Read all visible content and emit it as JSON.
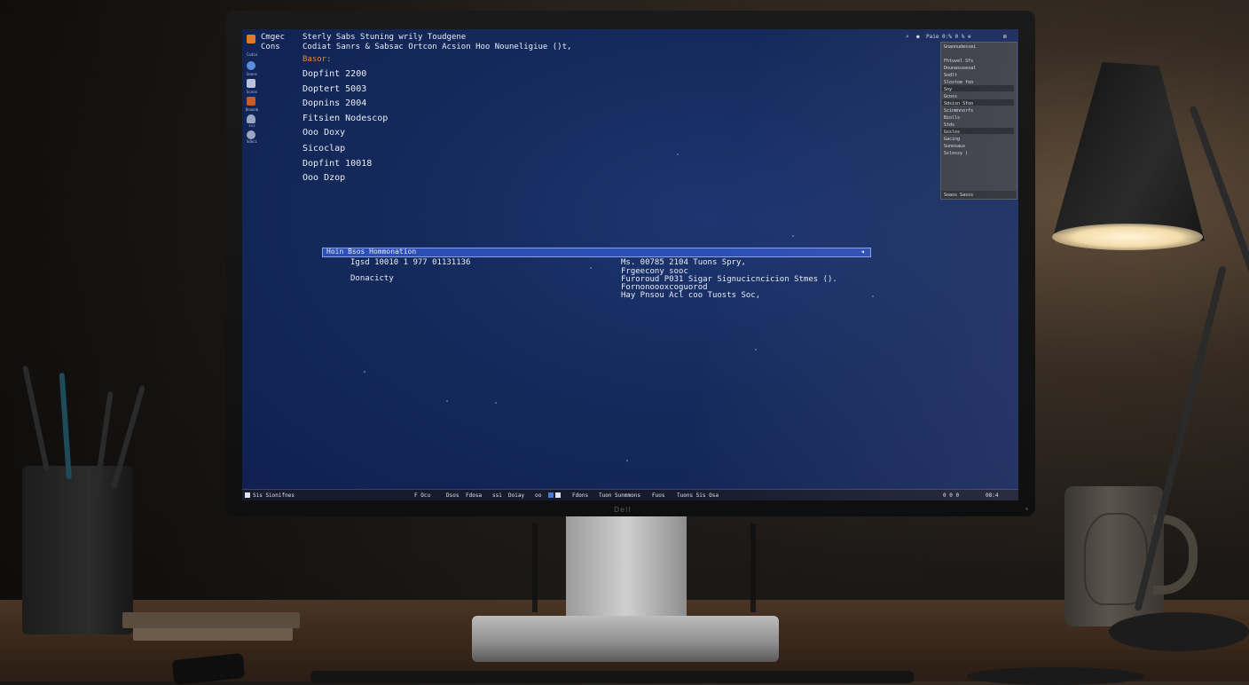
{
  "screen": {
    "header": {
      "app_name": "Cmgec",
      "app_sub": "Cons",
      "title_line1": "Sterly Sabs Stuning wrily Toudgene",
      "title_line2": "Codiat Sanrs & Sabsac Ortcon Acsion Hoo Nouneligiue ()t,",
      "section_label": "Basor:"
    },
    "list_items": [
      "Dopfint 2200",
      "Doptert 5003",
      "Dopnins 2004",
      "Fitsien Nodescop",
      "Ooo Doxy",
      "Sicoclap",
      "Dopfint 10018",
      "Ooo Dzop"
    ],
    "dialog": {
      "bar_title": "Hoin Bsos Hommonation",
      "left_line1": "Igsd 10010 1 977 01131136",
      "left_line2": "Donacicty",
      "right_line1": "Ms. 00785 2104 Tuons Spry,",
      "right_line2": "Frgeecony sooc",
      "right_line3": "Furoroud P031 Sigar Signucicncicion Stmes ().",
      "right_line4": "Fornonoooxcoguorod",
      "right_line5": "Hay Pnsou Acl coo Tuosts Soc,"
    },
    "top_right_icons": [
      "search-icon",
      "record-icon",
      "user-icon",
      "wifi-icon",
      "settings-icon",
      "close-icon"
    ],
    "top_right_text": "Paie 0:% 0 % ⊕",
    "right_panel": {
      "rows": [
        "Gnaonudessei",
        "Fhtuvel Sfs",
        "Dounasusesal",
        "Sodlt",
        "Slostoe foo",
        "Soy",
        "Gcoss",
        "Sdsisn Sfoo",
        "Scinmnnorfs",
        "Biolls",
        "Stds",
        "Gsslos",
        "Gacing",
        "Sunosaus",
        "Sslossy )"
      ],
      "footer": "Soaos Sasss"
    },
    "taskbar": {
      "start_label": "Sis Sionifnes",
      "items": [
        "F Ocu",
        "Dsos",
        "Fdosa",
        "ssi",
        "Doiay",
        "oo",
        "Fdons",
        "Tuon Sunmmons",
        "Fuos",
        "Tuons Sis Osa"
      ],
      "clock": "08:4",
      "tray": "0 0 0"
    },
    "dock": [
      {
        "label": "Codia",
        "icon": "folder-icon",
        "color": "#e07a2c"
      },
      {
        "label": "Gnnoc",
        "icon": "globe-icon",
        "color": "#5a8fe0"
      },
      {
        "label": "Scoos",
        "icon": "terminal-icon",
        "color": "#b8c2da"
      },
      {
        "label": "Dnonob",
        "icon": "image-icon",
        "color": "#c95a2a"
      },
      {
        "label": "sis",
        "icon": "people-icon",
        "color": "#9aa6c4"
      },
      {
        "label": "Sdoci",
        "icon": "gear-icon",
        "color": "#9aa6c4"
      }
    ]
  },
  "monitor": {
    "brand": "Dell"
  },
  "colors": {
    "screen_bg": "#152a5c",
    "accent_orange": "#e08a3a",
    "dialog_bar": "#2c4fb5",
    "text": "#e8ecf6"
  }
}
